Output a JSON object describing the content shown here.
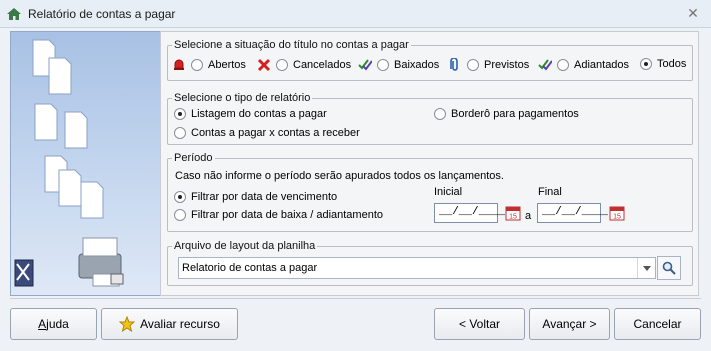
{
  "window": {
    "title": "Relatório de contas a pagar",
    "app_icon": "home-icon",
    "close_icon": "close-icon"
  },
  "situacao": {
    "legend": "Selecione a situação do título no contas a pagar",
    "options": [
      {
        "icon": "bell-icon",
        "label": "Abertos",
        "selected": false
      },
      {
        "icon": "red-x-icon",
        "label": "Cancelados",
        "selected": false
      },
      {
        "icon": "double-check-icon",
        "label": "Baixados",
        "selected": false
      },
      {
        "icon": "paperclip-icon",
        "label": "Previstos",
        "selected": false
      },
      {
        "icon": "double-check-icon",
        "label": "Adiantados",
        "selected": false
      },
      {
        "icon": "",
        "label": "Todos",
        "selected": true
      }
    ]
  },
  "tipo": {
    "legend": "Selecione o tipo de relatório",
    "listagem": "Listagem do contas a pagar",
    "bordero": "Borderô para pagamentos",
    "pagar_receber": "Contas a pagar x contas a receber",
    "selected": "listagem"
  },
  "periodo": {
    "legend": "Período",
    "note": "Caso não informe o período serão apurados todos os lançamentos.",
    "vencimento": "Filtrar por data de vencimento",
    "baixa": "Filtrar por data de baixa / adiantamento",
    "selected": "vencimento",
    "initial_label": "Inicial",
    "final_label": "Final",
    "initial_value": "__/__/____",
    "final_value": "__/__/____",
    "between": "a"
  },
  "arquivo": {
    "legend": "Arquivo de layout da planilha",
    "value": "Relatorio de contas a pagar"
  },
  "buttons": {
    "help": "Ajuda",
    "help_underline": "A",
    "rate": "Avaliar recurso",
    "back": "< Voltar",
    "next": "Avançar >",
    "cancel": "Cancelar"
  },
  "colors": {
    "accent_blue": "#2a5fb4",
    "red": "#d62020",
    "green": "#2e8b2e"
  }
}
